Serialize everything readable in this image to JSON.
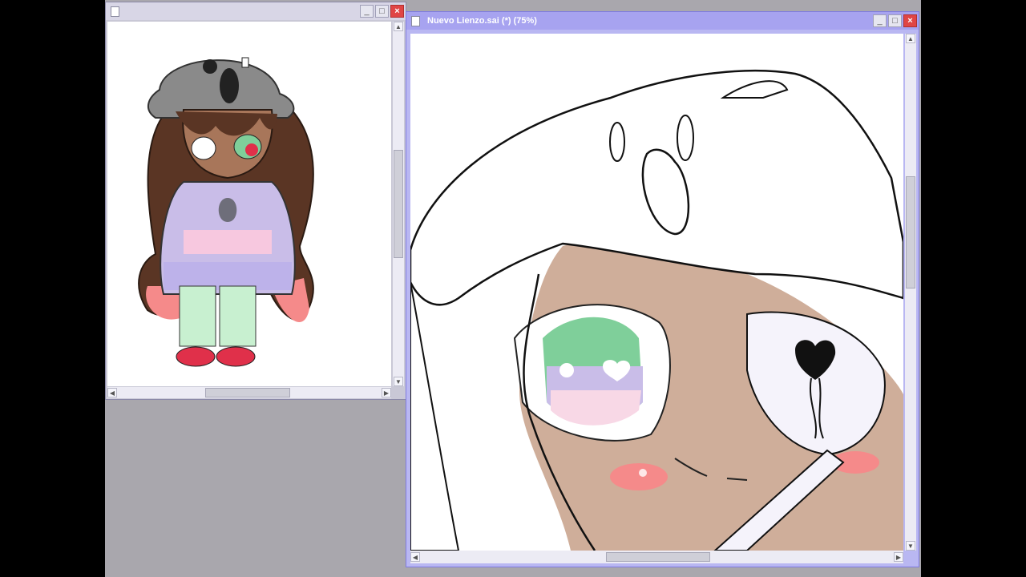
{
  "left_window": {
    "title": "",
    "controls": {
      "minimize": "_",
      "maximize": "□",
      "close": "×"
    }
  },
  "right_window": {
    "title": "Nuevo Lienzo.sai (*) (75%)",
    "controls": {
      "minimize": "_",
      "maximize": "□",
      "close": "×"
    }
  },
  "scroll_arrows": {
    "up": "▲",
    "down": "▼",
    "left": "◀",
    "right": "▶"
  },
  "colors": {
    "hair_brown": "#5a3524",
    "skin": "#cfae9a",
    "eye_green": "#7fcf9a",
    "pink": "#f58a8a",
    "lavender": "#c9bde8",
    "right_title_bar": "#a7a3f0"
  }
}
